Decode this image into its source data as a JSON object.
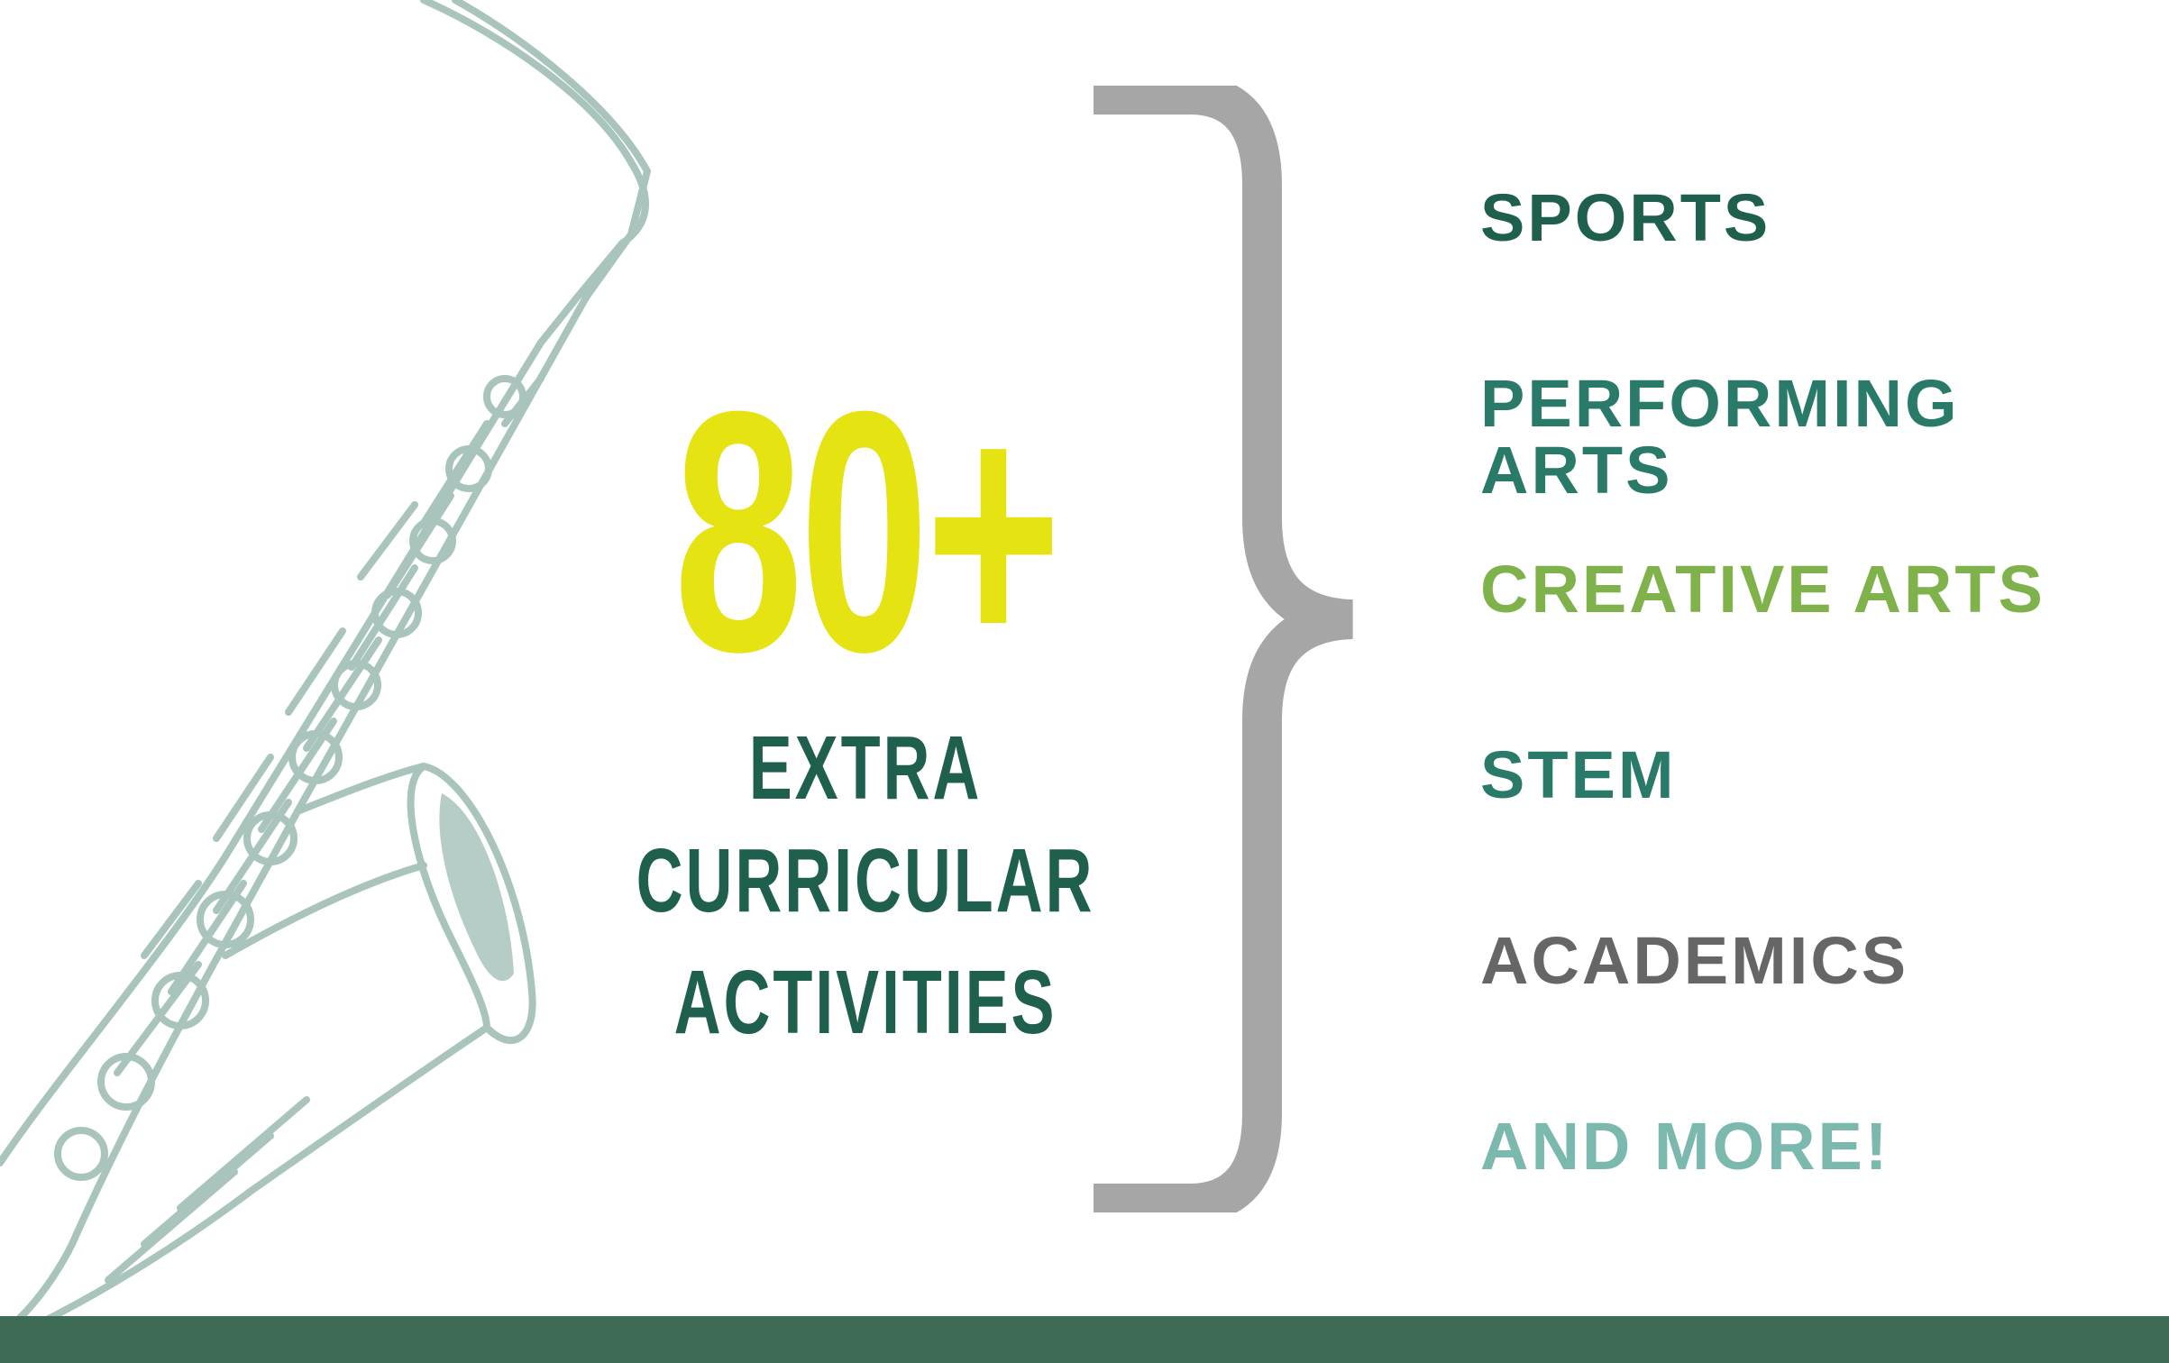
{
  "colors": {
    "background": "#ffffff",
    "headline_number": "#e5e312",
    "headline_text": "#1f5f4e",
    "brace": "#a6a6a6",
    "saxophone_line": "#a9c4bd",
    "footer_bar": "#3d6b56"
  },
  "stat": {
    "number": "80+",
    "caption_line1": "EXTRA CURRICULAR",
    "caption_line2": "ACTIVITIES"
  },
  "categories": [
    {
      "label": "SPORTS",
      "color": "#1f5f4e"
    },
    {
      "label": "PERFORMING ARTS",
      "color": "#2a7a6a"
    },
    {
      "label": "CREATIVE ARTS",
      "color": "#7fb24a"
    },
    {
      "label": "STEM",
      "color": "#2a7a6a"
    },
    {
      "label": "ACADEMICS",
      "color": "#666666"
    },
    {
      "label": "AND MORE!",
      "color": "#7bb8ae"
    }
  ],
  "illustration": {
    "icon": "saxophone-icon"
  }
}
